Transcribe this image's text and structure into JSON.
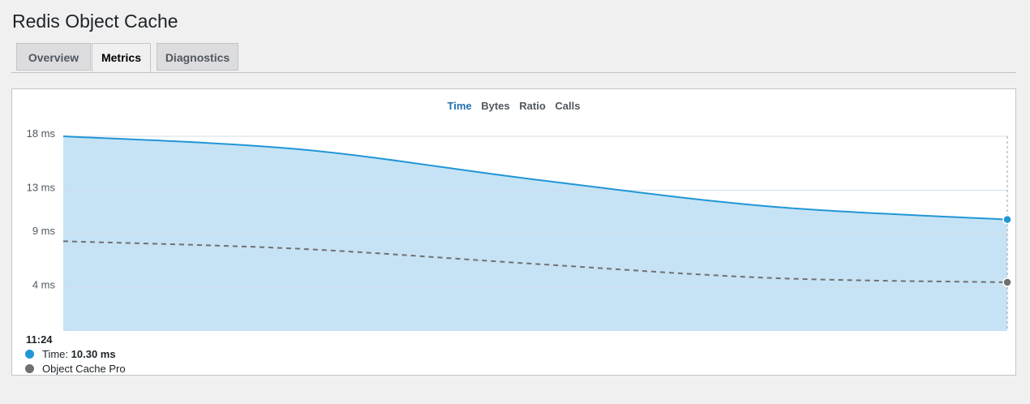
{
  "page": {
    "title": "Redis Object Cache"
  },
  "tabs": [
    {
      "label": "Overview",
      "active": false
    },
    {
      "label": "Metrics",
      "active": true
    },
    {
      "label": "Diagnostics",
      "active": false
    }
  ],
  "chart_nav": [
    {
      "label": "Time",
      "active": true
    },
    {
      "label": "Bytes",
      "active": false
    },
    {
      "label": "Ratio",
      "active": false
    },
    {
      "label": "Calls",
      "active": false
    }
  ],
  "colors": {
    "accent": "#2271b1",
    "time_line": "#2196d6",
    "time_fill": "#c6e3f5",
    "pro_line": "#707070",
    "grid": "#d0dde8"
  },
  "tooltip": {
    "time": "11:24",
    "series_1_label": "Time:",
    "series_1_value": "10.30 ms",
    "series_2_label": "Object Cache Pro"
  },
  "chart_data": {
    "type": "area",
    "title": "",
    "xlabel": "",
    "ylabel": "",
    "y_ticks": [
      "18 ms",
      "13 ms",
      "9 ms",
      "4 ms"
    ],
    "y_tick_values": [
      18,
      13,
      9,
      4
    ],
    "ylim": [
      0,
      18
    ],
    "grid": true,
    "series": [
      {
        "name": "Time",
        "style": "solid-area",
        "x": [
          0,
          0.25,
          0.5,
          0.75,
          1
        ],
        "y": [
          18.0,
          16.8,
          14.0,
          11.5,
          10.3
        ]
      },
      {
        "name": "Object Cache Pro",
        "style": "dashed",
        "x": [
          0,
          0.25,
          0.5,
          0.75,
          1
        ],
        "y": [
          8.3,
          7.6,
          6.2,
          4.9,
          4.5
        ]
      }
    ]
  }
}
